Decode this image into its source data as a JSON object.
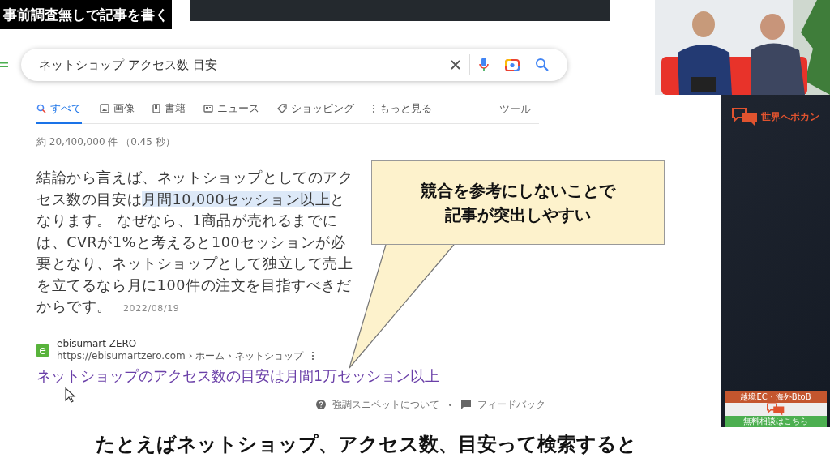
{
  "title_caption": "事前調査無しで記事を書く",
  "search": {
    "value": "ネットショップ アクセス数 目安"
  },
  "tabs": [
    {
      "label": "すべて",
      "selected": true
    },
    {
      "label": "画像",
      "selected": false
    },
    {
      "label": "書籍",
      "selected": false
    },
    {
      "label": "ニュース",
      "selected": false
    },
    {
      "label": "ショッピング",
      "selected": false
    },
    {
      "label": "もっと見る",
      "selected": false
    }
  ],
  "tools": "ツール",
  "result_stats": "約 20,400,000 件 （0.45 秒）",
  "snippet": {
    "parts": [
      {
        "text": "結論から言えば、ネットショップとしてのアクセス数の目安は",
        "highlighted": false
      },
      {
        "text": "月間10,000セッション以上",
        "highlighted": true
      },
      {
        "text": "となります。 なぜなら、1商品が売れるまでには、CVRが1%と考えると100セッションが必要となり、ネットショップとして独立して売上を立てるなら月に100件の注文を目指すべきだからです。",
        "highlighted": false
      }
    ],
    "date": "2022/08/19"
  },
  "result": {
    "site": "ebisumart ZERO",
    "url": "https://ebisumartzero.com › ホーム › ネットショップ",
    "favicon": "e",
    "title": "ネットショップのアクセス数の目安は月間1万セッション以上"
  },
  "footer_links": [
    "強調スニペットについて",
    "フィードバック"
  ],
  "callout": [
    "競合を参考にしないことで",
    "記事が突出しやすい"
  ],
  "brand": {
    "name": "世界へボカン"
  },
  "banner": [
    "越境EC・海外BtoB",
    "無料相談はこちら"
  ],
  "subtitle": "たとえばネットショップ、アクセス数、目安って検索すると"
}
